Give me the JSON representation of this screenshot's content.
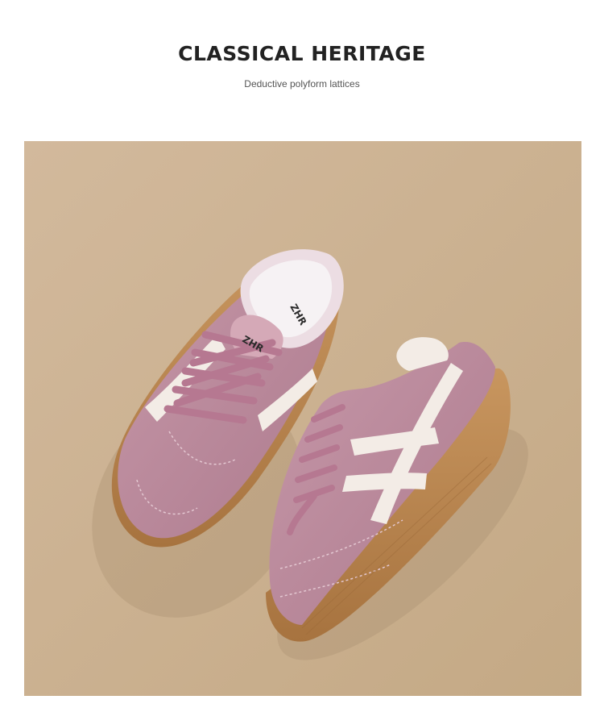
{
  "header": {
    "title": "CLASSICAL HERITAGE",
    "subtitle": "Deductive polyform lattices"
  },
  "product": {
    "brand_mark": "ZHR",
    "colors": {
      "background": "#cbb193",
      "suede": "#b98598",
      "stripe": "#f3ece6",
      "sole": "#b88450",
      "lining": "#efe9ec"
    }
  }
}
